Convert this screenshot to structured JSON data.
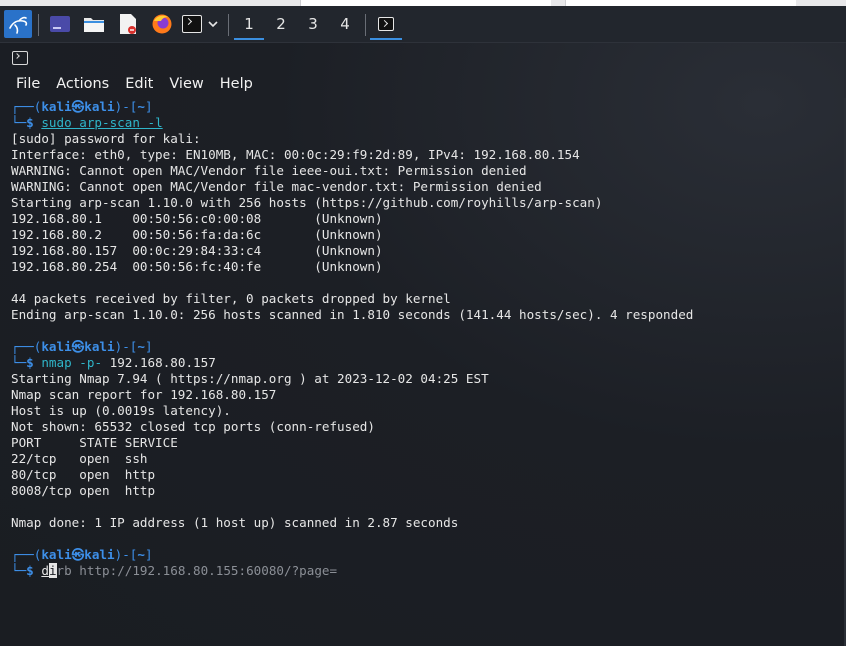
{
  "taskbar": {
    "workspaces": [
      "1",
      "2",
      "3",
      "4"
    ],
    "active_workspace": "1",
    "icons": [
      "kali-menu-icon",
      "show-desktop-icon",
      "file-manager-icon",
      "text-editor-icon",
      "firefox-icon",
      "terminal-icon",
      "dropdown-chevron-icon",
      "active-terminal-icon"
    ]
  },
  "window": {
    "menu": [
      "File",
      "Actions",
      "Edit",
      "View",
      "Help"
    ]
  },
  "prompt": {
    "user_host": "kali㉿kali",
    "dir": "~"
  },
  "session": {
    "cmd1": "sudo arp-scan -l",
    "cmd2_prog": "nmap",
    "cmd2_flag": "-p-",
    "cmd2_arg": "192.168.80.157",
    "cmd3_typed": "d",
    "cmd3_cursor": "i",
    "cmd3_suggest": "rb http://192.168.80.155:60080/?page=",
    "out1": [
      "[sudo] password for kali:",
      "Interface: eth0, type: EN10MB, MAC: 00:0c:29:f9:2d:89, IPv4: 192.168.80.154",
      "WARNING: Cannot open MAC/Vendor file ieee-oui.txt: Permission denied",
      "WARNING: Cannot open MAC/Vendor file mac-vendor.txt: Permission denied",
      "Starting arp-scan 1.10.0 with 256 hosts (https://github.com/royhills/arp-scan)",
      "192.168.80.1    00:50:56:c0:00:08       (Unknown)",
      "192.168.80.2    00:50:56:fa:da:6c       (Unknown)",
      "192.168.80.157  00:0c:29:84:33:c4       (Unknown)",
      "192.168.80.254  00:50:56:fc:40:fe       (Unknown)",
      "",
      "44 packets received by filter, 0 packets dropped by kernel",
      "Ending arp-scan 1.10.0: 256 hosts scanned in 1.810 seconds (141.44 hosts/sec). 4 responded"
    ],
    "out2": [
      "Starting Nmap 7.94 ( https://nmap.org ) at 2023-12-02 04:25 EST",
      "Nmap scan report for 192.168.80.157",
      "Host is up (0.0019s latency).",
      "Not shown: 65532 closed tcp ports (conn-refused)",
      "PORT     STATE SERVICE",
      "22/tcp   open  ssh",
      "80/tcp   open  http",
      "8008/tcp open  http",
      "",
      "Nmap done: 1 IP address (1 host up) scanned in 2.87 seconds"
    ]
  }
}
